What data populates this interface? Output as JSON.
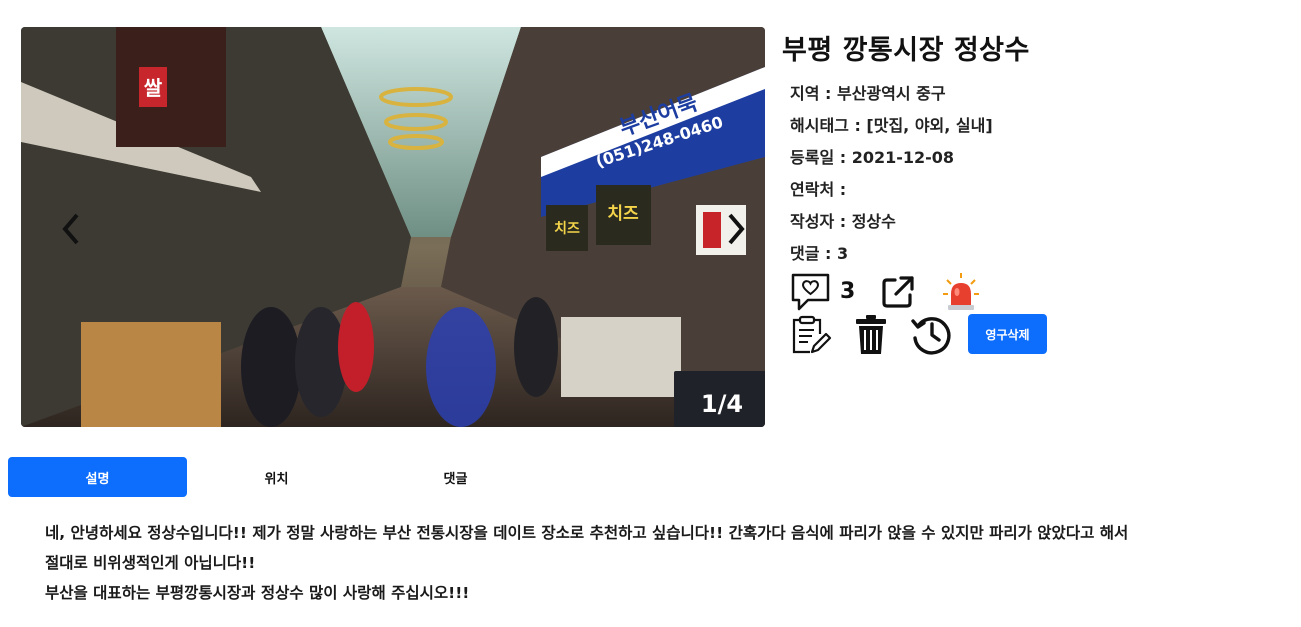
{
  "carousel": {
    "counter": "1/4",
    "prev_icon": "chevron-left-icon",
    "next_icon": "chevron-right-icon",
    "photo_signs": {
      "sign1": "쌀",
      "sign2": "치즈",
      "sign3": "치즈",
      "sign4": "부산어묵",
      "sign5": "(051)248-0460"
    }
  },
  "post": {
    "title": "부평 깡통시장 정상수",
    "region": "지역 : 부산광역시 중구",
    "hashtags": "해시태그 : [맛집, 야외, 실내]",
    "registered": "등록일 : 2021-12-08",
    "contact": "연락처 :",
    "author": "작성자 : 정상수",
    "comments": "댓글 : 3"
  },
  "actions": {
    "like_count": "3",
    "like_icon": "heart-speech-bubble-icon",
    "share_icon": "external-link-icon",
    "report_icon": "siren-icon",
    "edit_icon": "clipboard-pencil-icon",
    "delete_icon": "trash-icon",
    "history_icon": "history-icon",
    "delete_permanent_label": "영구삭제"
  },
  "tabs": [
    {
      "label": "설명",
      "active": true
    },
    {
      "label": "위치",
      "active": false
    },
    {
      "label": "댓글",
      "active": false
    }
  ],
  "description": {
    "line1": "네, 안녕하세요 정상수입니다!! 제가 정말 사랑하는 부산 전통시장을 데이트 장소로 추천하고 싶습니다!! 간혹가다 음식에 파리가 앉을 수 있지만 파리가 앉았다고 해서",
    "line2": "절대로 비위생적인게 아닙니다!!",
    "line3": "부산을 대표하는 부평깡통시장과 정상수 많이 사랑해 주십시오!!!"
  },
  "colors": {
    "accent": "#0d6efd",
    "counter_bg": "#1f2228",
    "siren": "#e8402f"
  }
}
